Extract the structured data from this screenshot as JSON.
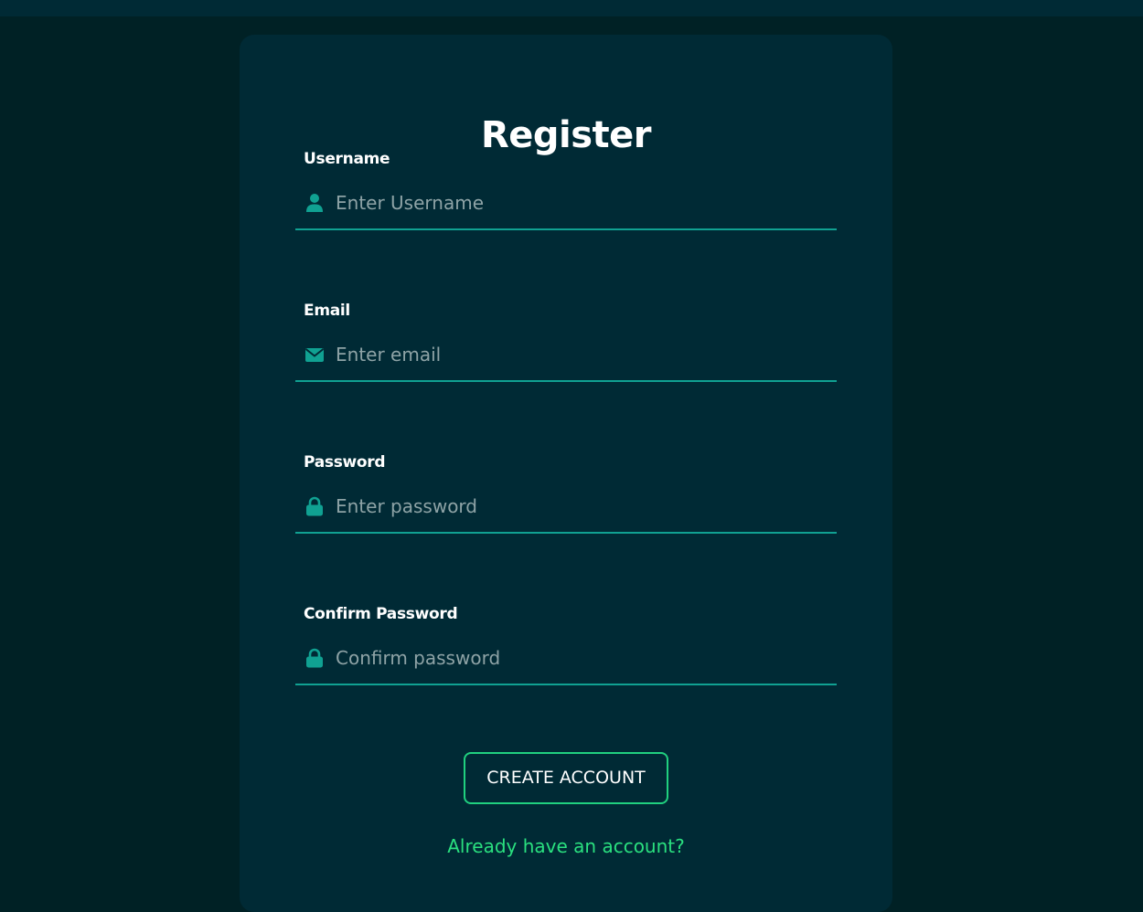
{
  "form": {
    "title": "Register",
    "fields": [
      {
        "label": "Username",
        "placeholder": "Enter Username",
        "icon": "user-icon",
        "value": ""
      },
      {
        "label": "Email",
        "placeholder": "Enter email",
        "icon": "envelope-icon",
        "value": ""
      },
      {
        "label": "Password",
        "placeholder": "Enter password",
        "icon": "lock-icon",
        "value": ""
      },
      {
        "label": "Confirm Password",
        "placeholder": "Confirm password",
        "icon": "lock-icon",
        "value": ""
      }
    ],
    "submit_label": "CREATE ACCOUNT",
    "login_link": "Already have an account?"
  },
  "colors": {
    "page_background": "#002125",
    "card_background": "#002a35",
    "accent": "#10a192",
    "button_border": "#20d07f",
    "link": "#2ae07f",
    "placeholder": "#8ea3a6",
    "text": "#ffffff"
  }
}
